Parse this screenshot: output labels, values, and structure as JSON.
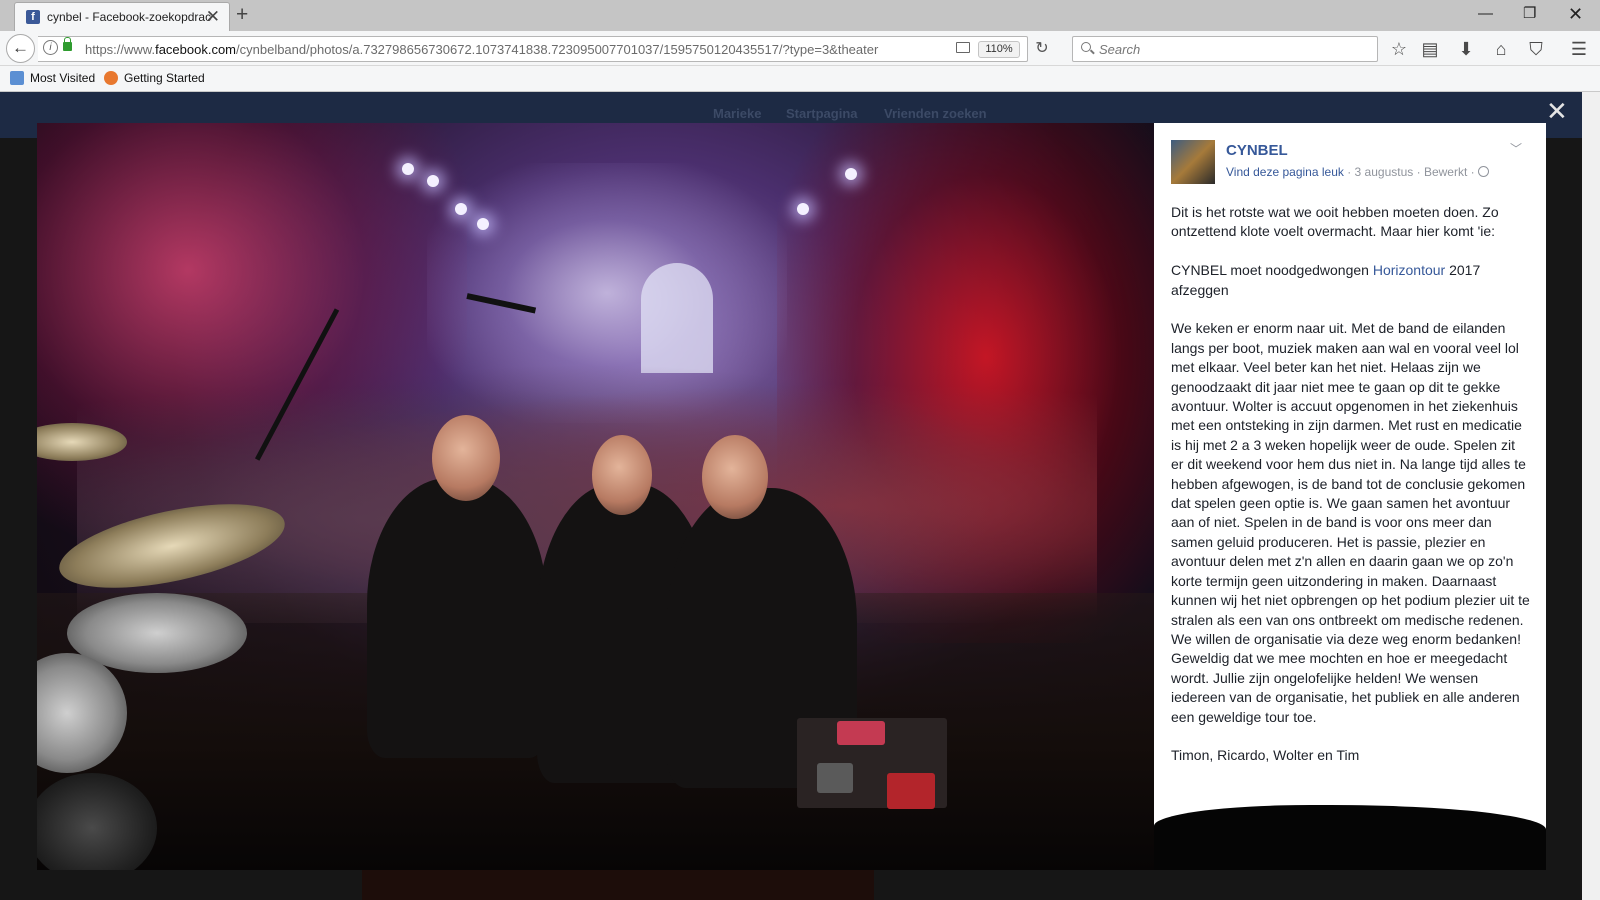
{
  "browser": {
    "tab_title": "cynbel - Facebook-zoekopdracht",
    "url_prefix": "https://www.",
    "url_domain": "facebook.com",
    "url_rest": "/cynbelband/photos/a.732798656730672.1073741838.723095007701037/1595750120435517/?type=3&theater",
    "zoom": "110%",
    "search_placeholder": "Search",
    "bookmarks": [
      "Most Visited",
      "Getting Started"
    ]
  },
  "facebook_nav": [
    "Marieke",
    "Startpagina",
    "Vrienden zoeken"
  ],
  "post": {
    "page_name": "CYNBEL",
    "like_link": "Vind deze pagina leuk",
    "date": "3 augustus",
    "edited": "Bewerkt",
    "separator": " · ",
    "para1": "Dit is het rotste wat we ooit hebben moeten doen. Zo ontzettend klote voelt overmacht. Maar hier komt 'ie:",
    "para2_a": "CYNBEL moet noodgedwongen ",
    "para2_link": "Horizontour",
    "para2_b": " 2017 afzeggen",
    "para3": "We keken er enorm naar uit. Met de band de eilanden langs per boot, muziek maken aan wal en vooral veel lol met elkaar. Veel beter kan het niet. Helaas zijn we genoodzaakt dit jaar niet mee te gaan op dit te gekke avontuur. Wolter is accuut opgenomen in het ziekenhuis met een ontsteking in zijn darmen. Met rust en medicatie is hij met 2 a 3 weken hopelijk weer de oude. Spelen zit er dit weekend voor hem dus niet in. Na lange tijd alles te hebben afgewogen, is de band tot de conclusie gekomen dat spelen geen optie is. We gaan samen het avontuur aan of niet. Spelen in de band is voor ons meer dan samen geluid produceren. Het is passie, plezier en avontuur delen met z'n allen en daarin gaan we op zo'n korte termijn geen uitzondering in maken. Daarnaast kunnen wij het niet opbrengen op het podium plezier uit te stralen als een van ons ontbreekt om medische redenen. We willen de organisatie via deze weg enorm bedanken! Geweldig dat we mee mochten en hoe er meegedacht wordt. Jullie zijn ongelofelijke helden! We wensen iedereen van de organisatie, het publiek en alle anderen een geweldige tour toe.",
    "signoff": "Timon, Ricardo, Wolter en Tim"
  },
  "icons": [
    "facebook-favicon",
    "back-icon",
    "info-icon",
    "lock-icon",
    "reader-icon",
    "reload-icon",
    "search-icon",
    "star-icon",
    "library-icon",
    "download-icon",
    "home-icon",
    "pocket-icon",
    "menu-icon",
    "close-icon",
    "globe-icon",
    "chevron-down-icon"
  ],
  "colors": {
    "facebook_blue": "#3b5998",
    "link": "#365899"
  }
}
